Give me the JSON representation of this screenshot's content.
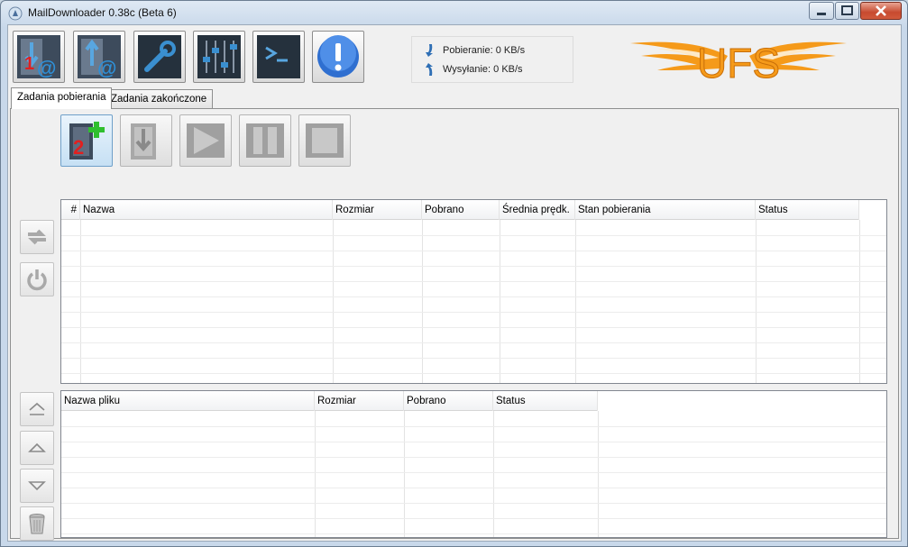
{
  "window": {
    "title": "MailDownloader 0.38c (Beta 6)"
  },
  "toolbar": {
    "buttons": [
      {
        "name": "download-mail",
        "badge": "1"
      },
      {
        "name": "upload-mail"
      },
      {
        "name": "settings"
      },
      {
        "name": "mixer"
      },
      {
        "name": "console"
      },
      {
        "name": "about"
      }
    ]
  },
  "speed": {
    "download_label": "Pobieranie: 0 KB/s",
    "upload_label": "Wysyłanie: 0 KB/s"
  },
  "logo": {
    "text": "UFS"
  },
  "tabs": [
    {
      "label": "Zadania pobierania",
      "active": true
    },
    {
      "label": "Zadania zakończone",
      "active": false
    }
  ],
  "actions": {
    "add_badge": "2"
  },
  "tasks_table": {
    "columns": [
      "#",
      "Nazwa",
      "Rozmiar",
      "Pobrano",
      "Średnia prędk.",
      "Stan pobierania",
      "Status"
    ]
  },
  "files_table": {
    "columns": [
      "Nazwa pliku",
      "Rozmiar",
      "Pobrano",
      "Status"
    ]
  }
}
